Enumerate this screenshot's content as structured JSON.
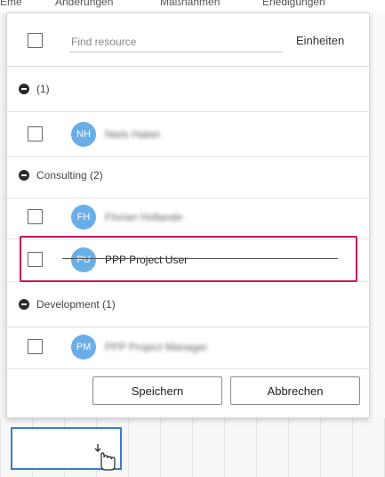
{
  "background": {
    "topbar_items": [
      "Eme",
      "Anderungen",
      "Maßnahmen",
      "Erledigungen"
    ]
  },
  "dialog": {
    "search": {
      "placeholder": "Find resource",
      "value": ""
    },
    "units_label": "Einheiten",
    "groups": [
      {
        "label": "(1)",
        "resources": [
          {
            "initials": "NH",
            "name": "Niels Habel",
            "blurred": true
          }
        ]
      },
      {
        "label": "Consulting (2)",
        "resources": [
          {
            "initials": "FH",
            "name": "Florian Hollande",
            "blurred": true
          },
          {
            "initials": "PU",
            "name": "PPP Project User",
            "blurred": false,
            "highlighted": true
          }
        ]
      },
      {
        "label": "Development (1)",
        "resources": [
          {
            "initials": "PM",
            "name": "PPP Project Manager",
            "blurred": true
          }
        ]
      }
    ],
    "save_label": "Speichern",
    "cancel_label": "Abbrechen"
  },
  "colors": {
    "avatar": "#6aaee8",
    "highlight": "#c2185b",
    "selection": "#3a7bd5"
  }
}
